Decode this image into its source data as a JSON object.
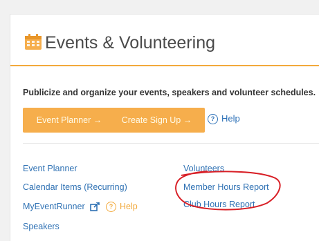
{
  "section": {
    "title": "Events & Volunteering",
    "description": "Publicize and organize your events, speakers and volunteer schedules."
  },
  "buttons": {
    "event_planner": "Event Planner →",
    "create_sign_up": "Create Sign Up →",
    "help": "Help"
  },
  "links": {
    "left": {
      "event_planner": "Event Planner",
      "calendar_items": "Calendar Items (Recurring)",
      "myeventrunner": "MyEventRunner",
      "help": "Help",
      "speakers": "Speakers"
    },
    "right": {
      "volunteers": "Volunteers",
      "member_hours_report": "Member Hours Report",
      "club_hours_report": "Club Hours Report"
    }
  },
  "icons": {
    "header": "calendar-icon",
    "help": "question-circle-icon",
    "external": "external-link-icon"
  },
  "colors": {
    "accent_orange": "#f6ae4c",
    "link_blue": "#2d70b3",
    "annotation_red": "#d81f26"
  }
}
